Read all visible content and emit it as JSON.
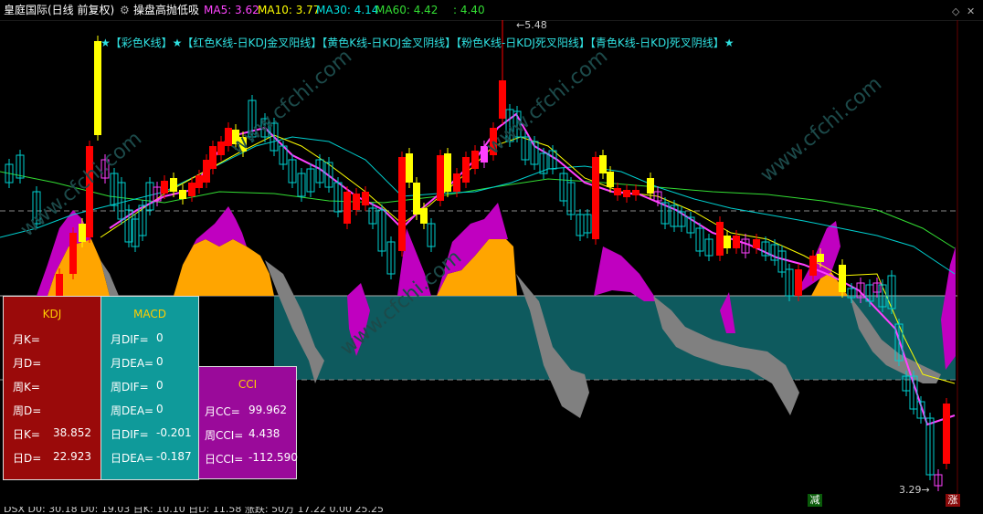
{
  "header": {
    "stock_title": "皇庭国际(日线 前复权)",
    "indicator_name": "操盘高抛低吸",
    "ma5": "MA5: 3.62",
    "ma10": "MA10: 3.77",
    "ma30": "MA30: 4.14",
    "ma60": "MA60: 4.42",
    "extra": ": 4.40",
    "colors": {
      "ma5": "#ff44ff",
      "ma10": "#ffff00",
      "ma30": "#00e0e0",
      "ma60": "#33dd33"
    }
  },
  "legend_text": "★【彩色K线】★【红色K线-日KDJ金叉阳线】【黄色K线-日KDJ金叉阴线】【粉色K线-日KDJ死叉阳线】【青色K线-日KDJ死叉阴线】★",
  "annotations": {
    "high": "5.48",
    "low": "3.29"
  },
  "kdj_panel": {
    "title": "KDJ",
    "rows": [
      {
        "label": "月K=",
        "value": ""
      },
      {
        "label": "月D=",
        "value": ""
      },
      {
        "label": "周K=",
        "value": ""
      },
      {
        "label": "周D=",
        "value": ""
      },
      {
        "label": "日K=",
        "value": "38.852"
      },
      {
        "label": "日D=",
        "value": "22.923"
      }
    ]
  },
  "macd_panel": {
    "title": "MACD",
    "rows": [
      {
        "label": "月DIF=",
        "value": "0"
      },
      {
        "label": "月DEA=",
        "value": "0"
      },
      {
        "label": "周DIF=",
        "value": "0"
      },
      {
        "label": "周DEA=",
        "value": "0"
      },
      {
        "label": "日DIF=",
        "value": "-0.201"
      },
      {
        "label": "日DEA=",
        "value": "-0.187"
      }
    ]
  },
  "cci_panel": {
    "title": "CCI",
    "rows": [
      {
        "label": "月CC=",
        "value": "99.962"
      },
      {
        "label": "周CCI=",
        "value": "4.438"
      },
      {
        "label": "日CCI=",
        "value": "-112.590"
      }
    ]
  },
  "tags": {
    "reduce": "减",
    "rise": "涨"
  },
  "watermark": "www.cfchi.com",
  "bottom_bar": {
    "text": "DSX  D0: 30.18  D0: 19.03  日K: 10.10  日D: 11.58  涨跌: 50万  17.22  0.00  25.25"
  }
}
